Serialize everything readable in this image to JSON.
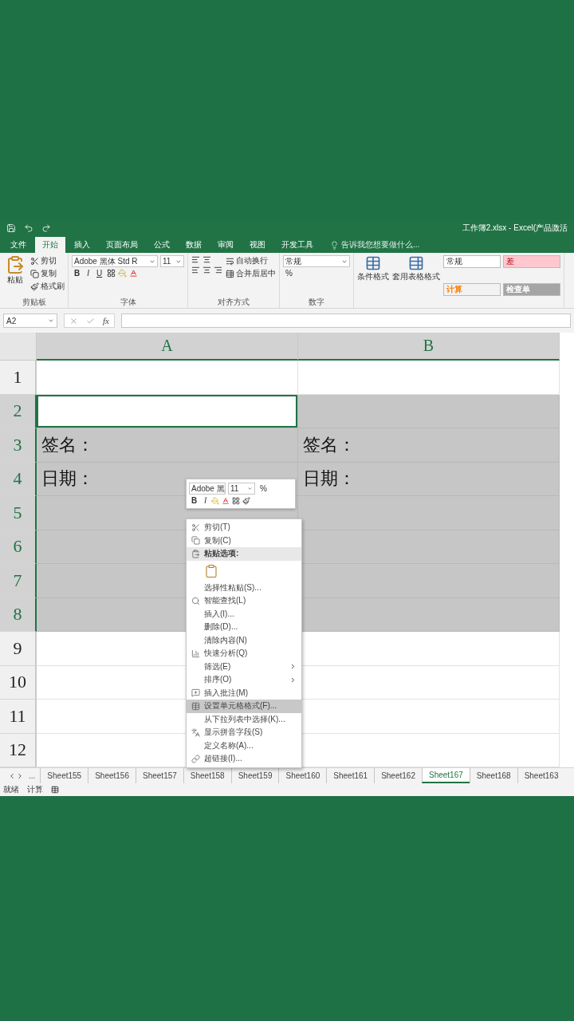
{
  "window": {
    "title": "工作簿2.xlsx - Excel(产品激活"
  },
  "ribbon_tabs": [
    {
      "label": "文件",
      "selected": false
    },
    {
      "label": "开始",
      "selected": true
    },
    {
      "label": "插入",
      "selected": false
    },
    {
      "label": "页面布局",
      "selected": false
    },
    {
      "label": "公式",
      "selected": false
    },
    {
      "label": "数据",
      "selected": false
    },
    {
      "label": "审阅",
      "selected": false
    },
    {
      "label": "视图",
      "selected": false
    },
    {
      "label": "开发工具",
      "selected": false
    }
  ],
  "tell_me": {
    "placeholder": "告诉我您想要做什么..."
  },
  "clipboard": {
    "paste": "粘贴",
    "cut": "剪切",
    "copy": "复制",
    "format_painter": "格式刷",
    "label": "剪贴板"
  },
  "font": {
    "name": "Adobe 黑体 Std R",
    "size": "11",
    "bold": "B",
    "italic": "I",
    "underline": "U",
    "label": "字体"
  },
  "alignment": {
    "wrap": "自动换行",
    "merge": "合并后居中",
    "label": "对齐方式"
  },
  "number": {
    "format": "常规",
    "percent": "%",
    "label": "数字"
  },
  "styles": {
    "conditional": "条件格式",
    "table": "套用表格格式",
    "cells": [
      {
        "label": "常规",
        "color": "#ffffff"
      },
      {
        "label": "差",
        "color": "#ffc7ce"
      },
      {
        "label": "计算",
        "color": "#f2f2f2"
      },
      {
        "label": "检查单",
        "color": "#a5a5a5"
      }
    ]
  },
  "formula_bar": {
    "name_box": "A2",
    "fx": "fx"
  },
  "columns": [
    {
      "label": "A",
      "selected": true
    },
    {
      "label": "B",
      "selected": true
    }
  ],
  "rows": [
    {
      "label": "1",
      "selected": false,
      "cells": [
        {
          "selected": false,
          "active": false
        },
        {
          "selected": false,
          "active": false
        }
      ]
    },
    {
      "label": "2",
      "selected": true,
      "cells": [
        {
          "selected": true,
          "active": true
        },
        {
          "selected": true,
          "active": false
        }
      ]
    },
    {
      "label": "3",
      "selected": true,
      "cells": [
        {
          "selected": true,
          "active": false,
          "text": "签名："
        },
        {
          "selected": true,
          "active": false,
          "text": "签名："
        }
      ]
    },
    {
      "label": "4",
      "selected": true,
      "cells": [
        {
          "selected": true,
          "active": false,
          "text": "日期："
        },
        {
          "selected": true,
          "active": false,
          "text": "日期："
        }
      ]
    },
    {
      "label": "5",
      "selected": true,
      "cells": [
        {
          "selected": true,
          "active": false
        },
        {
          "selected": true,
          "active": false
        }
      ]
    },
    {
      "label": "6",
      "selected": true,
      "cells": [
        {
          "selected": true,
          "active": false
        },
        {
          "selected": true,
          "active": false
        }
      ]
    },
    {
      "label": "7",
      "selected": true,
      "cells": [
        {
          "selected": true,
          "active": false
        },
        {
          "selected": true,
          "active": false
        }
      ]
    },
    {
      "label": "8",
      "selected": true,
      "cells": [
        {
          "selected": true,
          "active": false
        },
        {
          "selected": true,
          "active": false
        }
      ]
    },
    {
      "label": "9",
      "selected": false,
      "cells": [
        {
          "selected": false,
          "active": false
        },
        {
          "selected": false,
          "active": false
        }
      ]
    },
    {
      "label": "10",
      "selected": false,
      "cells": [
        {
          "selected": false,
          "active": false
        },
        {
          "selected": false,
          "active": false
        }
      ]
    },
    {
      "label": "11",
      "selected": false,
      "cells": [
        {
          "selected": false,
          "active": false
        },
        {
          "selected": false,
          "active": false
        }
      ]
    },
    {
      "label": "12",
      "selected": false,
      "cells": [
        {
          "selected": false,
          "active": false
        },
        {
          "selected": false,
          "active": false
        }
      ]
    }
  ],
  "mini_toolbar": {
    "font": "Adobe 黑",
    "size": "11",
    "percent": "%",
    "bold": "B",
    "italic": "I"
  },
  "context_menu": [
    {
      "kind": "item",
      "label": "剪切(T)",
      "selected": false,
      "submenu": false
    },
    {
      "kind": "item",
      "label": "复制(C)",
      "selected": false,
      "submenu": false
    },
    {
      "kind": "header",
      "label": "粘贴选项:",
      "selected": false,
      "submenu": false
    },
    {
      "kind": "paste",
      "selected": false,
      "submenu": false
    },
    {
      "kind": "item",
      "label": "选择性粘贴(S)...",
      "selected": false,
      "submenu": false
    },
    {
      "kind": "item",
      "label": "智能查找(L)",
      "selected": false,
      "submenu": false
    },
    {
      "kind": "item",
      "label": "插入(I)...",
      "selected": false,
      "submenu": false
    },
    {
      "kind": "item",
      "label": "删除(D)...",
      "selected": false,
      "submenu": false
    },
    {
      "kind": "item",
      "label": "清除内容(N)",
      "selected": false,
      "submenu": false
    },
    {
      "kind": "item",
      "label": "快速分析(Q)",
      "selected": false,
      "submenu": false
    },
    {
      "kind": "item",
      "label": "筛选(E)",
      "selected": false,
      "submenu": true
    },
    {
      "kind": "item",
      "label": "排序(O)",
      "selected": false,
      "submenu": true
    },
    {
      "kind": "item",
      "label": "插入批注(M)",
      "selected": false,
      "submenu": false
    },
    {
      "kind": "item",
      "label": "设置单元格格式(F)...",
      "selected": true,
      "submenu": false
    },
    {
      "kind": "item",
      "label": "从下拉列表中选择(K)...",
      "selected": false,
      "submenu": false
    },
    {
      "kind": "item",
      "label": "显示拼音字段(S)",
      "selected": false,
      "submenu": false
    },
    {
      "kind": "item",
      "label": "定义名称(A)...",
      "selected": false,
      "submenu": false
    },
    {
      "kind": "item",
      "label": "超链接(I)...",
      "selected": false,
      "submenu": false
    }
  ],
  "sheet_tabs": {
    "more": "...",
    "tabs": [
      {
        "label": "Sheet155",
        "selected": false
      },
      {
        "label": "Sheet156",
        "selected": false
      },
      {
        "label": "Sheet157",
        "selected": false
      },
      {
        "label": "Sheet158",
        "selected": false
      },
      {
        "label": "Sheet159",
        "selected": false
      },
      {
        "label": "Sheet160",
        "selected": false
      },
      {
        "label": "Sheet161",
        "selected": false
      },
      {
        "label": "Sheet162",
        "selected": false
      },
      {
        "label": "Sheet167",
        "selected": true
      },
      {
        "label": "Sheet168",
        "selected": false
      },
      {
        "label": "Sheet163",
        "selected": false
      }
    ]
  },
  "status_bar": {
    "ready": "就绪",
    "calc": "计算"
  }
}
